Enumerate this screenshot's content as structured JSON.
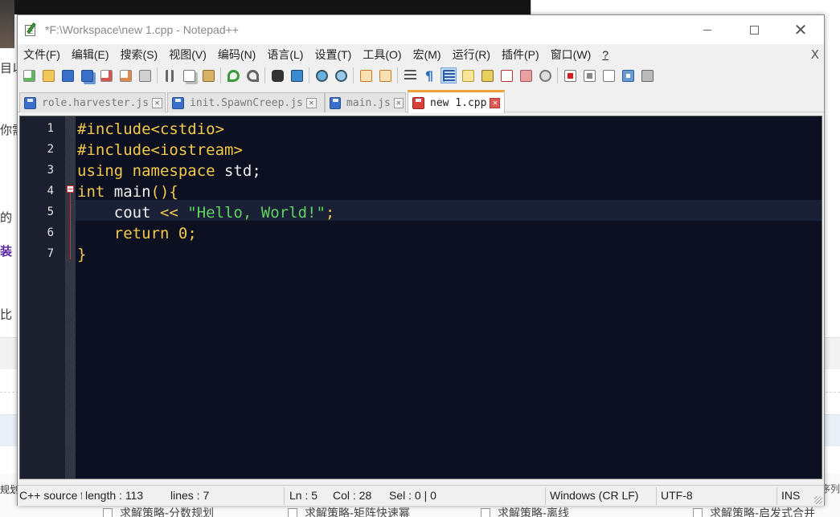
{
  "window": {
    "title": "*F:\\Workspace\\new 1.cpp - Notepad++",
    "menus": [
      "文件(F)",
      "编辑(E)",
      "搜索(S)",
      "视图(V)",
      "编码(N)",
      "语言(L)",
      "设置(T)",
      "工具(O)",
      "宏(M)",
      "运行(R)",
      "插件(P)",
      "窗口(W)",
      "?"
    ],
    "menu_close": "X"
  },
  "tabs": [
    {
      "label": "role.harvester.js",
      "active": false
    },
    {
      "label": "init.SpawnCreep.js",
      "active": false
    },
    {
      "label": "main.js",
      "active": false
    },
    {
      "label": "new 1.cpp",
      "active": true
    }
  ],
  "editor": {
    "line_numbers": [
      "1",
      "2",
      "3",
      "4",
      "5",
      "6",
      "7"
    ],
    "lines": [
      [
        {
          "t": "#include<cstdio>",
          "c": "pp"
        }
      ],
      [
        {
          "t": "#include<iostream>",
          "c": "pp"
        }
      ],
      [
        {
          "t": "using namespace",
          "c": "kw"
        },
        {
          "t": " std;",
          "c": "plain"
        }
      ],
      [
        {
          "t": "int",
          "c": "kw"
        },
        {
          "t": " main",
          "c": "plain"
        },
        {
          "t": "(){",
          "c": "op"
        }
      ],
      [
        {
          "t": "    cout ",
          "c": "plain"
        },
        {
          "t": "<<",
          "c": "op"
        },
        {
          "t": " ",
          "c": "plain"
        },
        {
          "t": "\"Hello, World!\"",
          "c": "str"
        },
        {
          "t": ";",
          "c": "op"
        }
      ],
      [
        {
          "t": "    ",
          "c": "plain"
        },
        {
          "t": "return",
          "c": "kw"
        },
        {
          "t": " ",
          "c": "plain"
        },
        {
          "t": "0",
          "c": "num"
        },
        {
          "t": ";",
          "c": "op"
        }
      ],
      [
        {
          "t": "}",
          "c": "op"
        }
      ]
    ],
    "colors": {
      "background": "#0d1021",
      "keyword": "#f2c94c",
      "string": "#5fd35f",
      "plain": "#f0f0f0"
    }
  },
  "status": {
    "file_type": "C++ source file",
    "length": "length : 113",
    "lines": "lines : 7",
    "ln": "Ln : 5",
    "col": "Col : 28",
    "sel": "Sel : 0 | 0",
    "eol": "Windows (CR LF)",
    "encoding": "UTF-8",
    "mode": "INS"
  },
  "background_page": {
    "edge_texts": [
      "目以",
      "你需",
      "的",
      "装",
      "比"
    ],
    "checkboxes": [
      "求解策略-分数规划",
      "求解策略-矩阵快速幂",
      "求解策略-离线",
      "求解策略-启发式合并"
    ],
    "right_bit": "序列",
    "left_bit": "规划"
  }
}
